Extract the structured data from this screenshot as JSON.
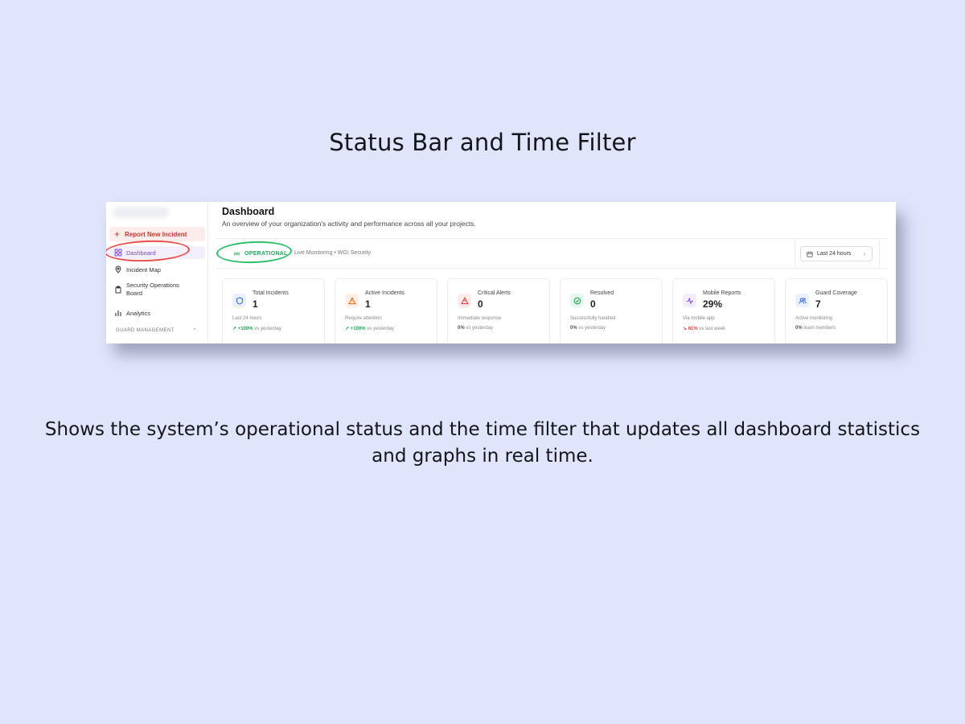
{
  "slide": {
    "title": "Status Bar and Time Filter",
    "caption": "Shows the system’s operational status and the time filter that updates all dashboard statistics and graphs in real time."
  },
  "sidebar": {
    "report_label": "Report New Incident",
    "items": [
      {
        "label": "Dashboard",
        "icon": "grid-icon",
        "active": true
      },
      {
        "label": "Incident Map",
        "icon": "map-pin-icon"
      },
      {
        "label": "Security Operations Board",
        "icon": "clipboard-icon"
      },
      {
        "label": "Analytics",
        "icon": "bar-chart-icon"
      }
    ],
    "section_label": "GUARD MANAGEMENT",
    "section_chevron": "^"
  },
  "header": {
    "title": "Dashboard",
    "subtitle": "An overview of your organization's activity and performance across all your projects."
  },
  "status_bar": {
    "status": "OPERATIONAL",
    "meta": "Live Monitoring • WGI Security",
    "time_filter": "Last 24 hours"
  },
  "cards": [
    {
      "title": "Total Incidents",
      "value": "1",
      "desc": "Last 24 hours",
      "trend_value": "+100%",
      "trend_text": "vs yesterday",
      "trend_dir": "up",
      "icon": "shield-icon",
      "color": "#3b6fe0",
      "bg": "#eaf0fd"
    },
    {
      "title": "Active Incidents",
      "value": "1",
      "desc": "Require attention",
      "trend_value": "+100%",
      "trend_text": "vs yesterday",
      "trend_dir": "up",
      "icon": "warning-icon",
      "color": "#e8731e",
      "bg": "#fdf0e6"
    },
    {
      "title": "Critical Alerts",
      "value": "0",
      "desc": "Immediate response",
      "trend_value": "0%",
      "trend_text": "vs yesterday",
      "trend_dir": "flat",
      "icon": "alert-icon",
      "color": "#e0453e",
      "bg": "#fdeceb"
    },
    {
      "title": "Resolved",
      "value": "0",
      "desc": "Successfully handled",
      "trend_value": "0%",
      "trend_text": "vs yesterday",
      "trend_dir": "flat",
      "icon": "check-circle-icon",
      "color": "#22a55a",
      "bg": "#e8f7ee"
    },
    {
      "title": "Mobile Reports",
      "value": "29%",
      "desc": "Via mobile app",
      "trend_value": "61%",
      "trend_text": "vs last week",
      "trend_dir": "down",
      "icon": "activity-icon",
      "color": "#8a4fe0",
      "bg": "#f2ecfd"
    },
    {
      "title": "Guard Coverage",
      "value": "7",
      "desc": "Active monitoring",
      "trend_value": "0%",
      "trend_text": "team members",
      "trend_dir": "flat",
      "icon": "users-icon",
      "color": "#3b6fe0",
      "bg": "#eaf0fd"
    }
  ]
}
